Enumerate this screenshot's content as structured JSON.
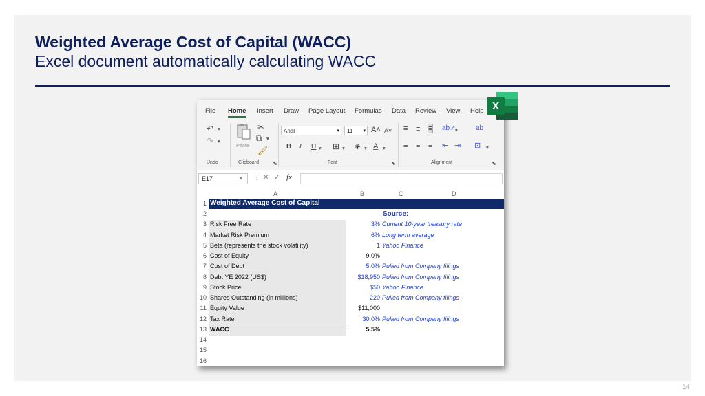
{
  "slide": {
    "title": "Weighted Average Cost of Capital (WACC)",
    "subtitle": "Excel document automatically calculating WACC",
    "page_number": "14",
    "accent_color": "#0d1f5c"
  },
  "excel": {
    "logo_letter": "X",
    "menu": [
      "File",
      "Home",
      "Insert",
      "Draw",
      "Page Layout",
      "Formulas",
      "Data",
      "Review",
      "View",
      "Help"
    ],
    "ribbon": {
      "font_name": "Arial",
      "font_size": "11",
      "paste_label": "Paste",
      "groups": [
        "Undo",
        "Clipboard",
        "Font",
        "Alignment"
      ]
    },
    "formula_bar": {
      "name_box": "E17",
      "fx": "fx",
      "value": ""
    },
    "columns": [
      "A",
      "B",
      "C",
      "D"
    ],
    "sheet_title": "Weighted Average Cost of Capital",
    "source_header": "Source:",
    "rows": [
      {
        "n": "1"
      },
      {
        "n": "2"
      },
      {
        "n": "3",
        "label": "Risk Free Rate",
        "value": "3%",
        "source": "Current 10-year treasury rate"
      },
      {
        "n": "4",
        "label": "Market Risk Premium",
        "value": "6%",
        "source": "Long term average"
      },
      {
        "n": "5",
        "label": "Beta (represents the stock volatility)",
        "value": "1",
        "source": "Yahoo Finance"
      },
      {
        "n": "6",
        "label": "Cost of Equity",
        "value": "9.0%",
        "source": ""
      },
      {
        "n": "7",
        "label": "Cost of Debt",
        "value": "5.0%",
        "source": "Pulled from Company filings"
      },
      {
        "n": "8",
        "label": "Debt YE 2022 (US$)",
        "value": "$18,950",
        "source": "Pulled from Company filings"
      },
      {
        "n": "9",
        "label": "Stock Price",
        "value": "$50",
        "source": "Yahoo Finance"
      },
      {
        "n": "10",
        "label": "Shares Outstanding (in millions)",
        "value": "220",
        "source": "Pulled from Company filings"
      },
      {
        "n": "11",
        "label": "Equity Value",
        "value": "$11,000",
        "source": ""
      },
      {
        "n": "12",
        "label": "Tax Rate",
        "value": "30.0%",
        "source": "Pulled from Company filings"
      },
      {
        "n": "13",
        "label": "WACC",
        "value": "5.5%",
        "source": ""
      },
      {
        "n": "14"
      },
      {
        "n": "15"
      },
      {
        "n": "16"
      }
    ]
  }
}
